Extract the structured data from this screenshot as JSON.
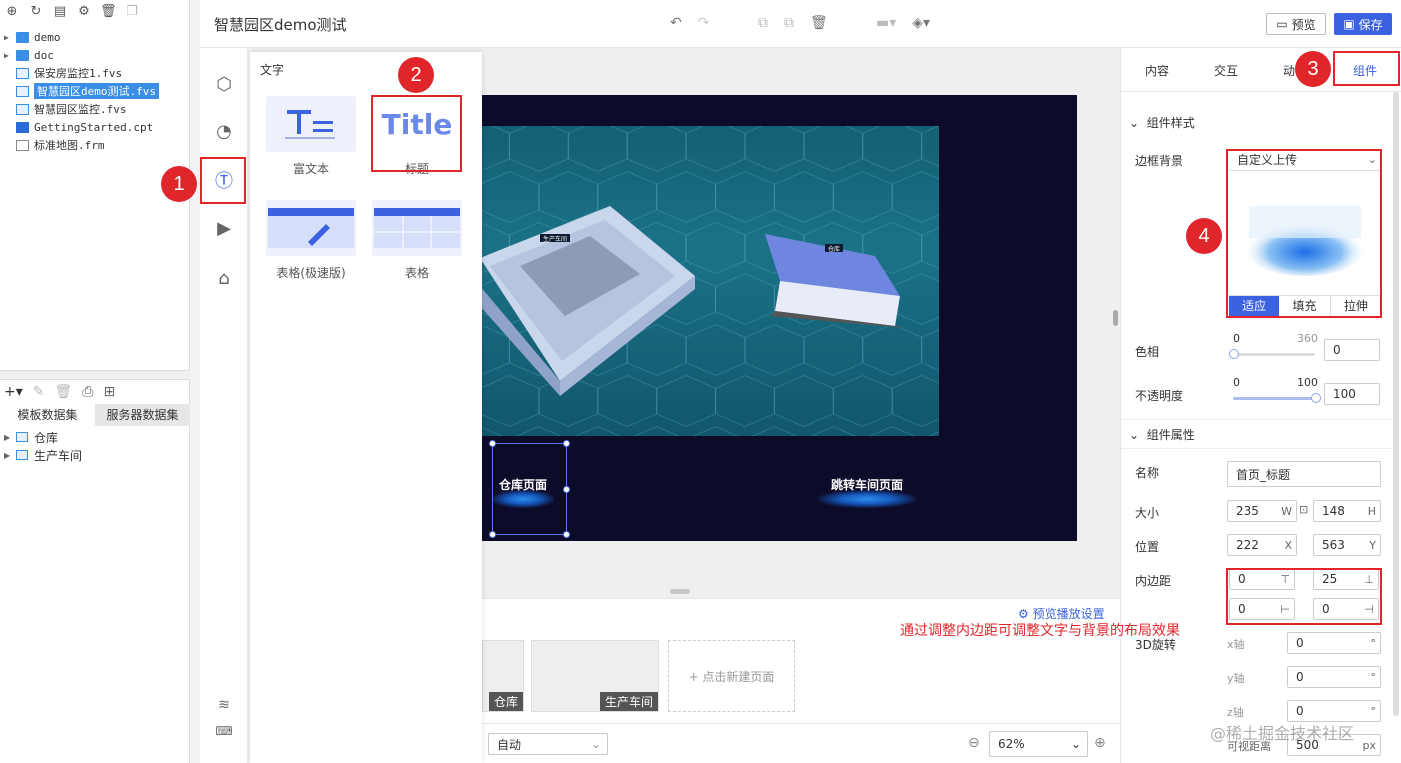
{
  "file_tree": {
    "items": [
      {
        "label": "demo",
        "type": "folder"
      },
      {
        "label": "doc",
        "type": "folder"
      },
      {
        "label": "保安房监控1.fvs",
        "type": "fvs"
      },
      {
        "label": "智慧园区demo测试.fvs",
        "type": "fvs",
        "selected": true
      },
      {
        "label": "智慧园区监控.fvs",
        "type": "fvs"
      },
      {
        "label": "GettingStarted.cpt",
        "type": "cpt"
      },
      {
        "label": "标准地图.frm",
        "type": "frm"
      }
    ]
  },
  "datasets": {
    "tabs": [
      "模板数据集",
      "服务器数据集"
    ],
    "items": [
      "仓库",
      "生产车间"
    ]
  },
  "header": {
    "title": "智慧园区demo测试",
    "preview_label": "预览",
    "save_label": "保存"
  },
  "widget_panel": {
    "title": "文字",
    "widgets": [
      {
        "label": "富文本"
      },
      {
        "label": "标题",
        "image_text": "Title"
      },
      {
        "label": "表格(极速版)"
      },
      {
        "label": "表格"
      }
    ]
  },
  "canvas": {
    "buttons": [
      "仓库页面",
      "跳转车间页面"
    ],
    "scene_tags": [
      "生产车间",
      "仓库"
    ]
  },
  "pages": {
    "preview_settings": "预览播放设置",
    "thumbs": [
      "仓库",
      "生产车间"
    ],
    "new_page": "+ 点击新建页面"
  },
  "bottom": {
    "auto_label": "自动",
    "zoom": "62%"
  },
  "right_panel": {
    "tabs": [
      "内容",
      "交互",
      "动",
      "组件"
    ],
    "style_section": "组件样式",
    "border_bg_label": "边框背景",
    "border_bg_value": "自定义上传",
    "fit_buttons": [
      "适应",
      "填充",
      "拉伸"
    ],
    "hue_label": "色相",
    "hue_min": "0",
    "hue_max": "360",
    "hue_value": "0",
    "opacity_label": "不透明度",
    "opacity_min": "0",
    "opacity_max": "100",
    "opacity_value": "100",
    "props_section": "组件属性",
    "name_label": "名称",
    "name_value": "首页_标题",
    "size_label": "大小",
    "width": "235",
    "width_unit": "W",
    "height": "148",
    "height_unit": "H",
    "pos_label": "位置",
    "x": "222",
    "x_unit": "X",
    "y": "563",
    "y_unit": "Y",
    "padding_label": "内边距",
    "padding_top": "0",
    "padding_bottom": "25",
    "padding_left": "0",
    "padding_right": "0",
    "rotate_label": "3D旋转",
    "x_axis_label": "x轴",
    "y_axis_label": "y轴",
    "z_axis_label": "z轴",
    "x_axis_value": "0",
    "y_axis_value": "0",
    "z_axis_value": "0",
    "degree_unit": "°",
    "view_distance_label": "可视距离",
    "view_distance": "500",
    "view_distance_unit": "px"
  },
  "annotations": {
    "badges": [
      "1",
      "2",
      "3",
      "4"
    ],
    "note": "通过调整内边距可调整文字与背景的布局效果",
    "watermark": "@稀土掘金技术社区"
  },
  "colors": {
    "accent": "#3b62e0",
    "annotation_red": "#e0262b",
    "canvas_bg": "#0d0b2a",
    "scene_teal": "#176a80"
  }
}
